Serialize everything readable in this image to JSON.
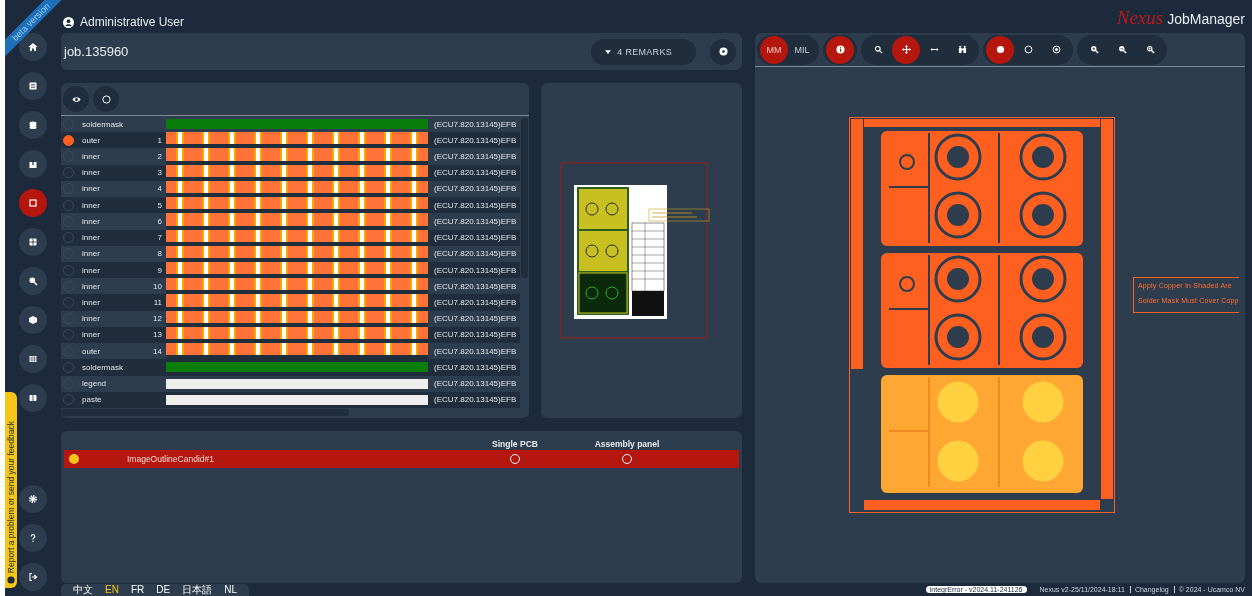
{
  "ribbon": "beta version",
  "feedback": "Report a problem or send your feedback",
  "user": "Administrative User",
  "logo": {
    "brand": "Nexus",
    "product": "JobManager"
  },
  "sidebar": {
    "items": [
      {
        "selected": false
      },
      {
        "selected": false
      },
      {
        "selected": false
      },
      {
        "selected": false
      },
      {
        "selected": true
      },
      {
        "selected": false
      },
      {
        "selected": false
      },
      {
        "selected": false
      },
      {
        "selected": false
      },
      {
        "selected": false
      }
    ],
    "bottom_items": [
      {
        "selected": false
      },
      {
        "selected": false
      },
      {
        "selected": false
      }
    ]
  },
  "job": {
    "title": "job.135960",
    "remarks_button": "4 REMARKS"
  },
  "layers": [
    {
      "name": "soldermask",
      "kind": "soldermask",
      "label": "(ECU7.820.13145)EFB",
      "selected": false
    },
    {
      "name": "outer",
      "number": "1",
      "kind": "copper",
      "label": "(ECU7.820.13145)EFB",
      "selected": true
    },
    {
      "name": "inner",
      "number": "2",
      "kind": "copper",
      "label": "(ECU7.820.13145)EFB",
      "selected": false
    },
    {
      "name": "inner",
      "number": "3",
      "kind": "copper",
      "label": "(ECU7.820.13145)EFB",
      "selected": false
    },
    {
      "name": "inner",
      "number": "4",
      "kind": "copper",
      "label": "(ECU7.820.13145)EFB",
      "selected": false
    },
    {
      "name": "inner",
      "number": "5",
      "kind": "copper",
      "label": "(ECU7.820.13145)EFB",
      "selected": false
    },
    {
      "name": "inner",
      "number": "6",
      "kind": "copper",
      "label": "(ECU7.820.13145)EFB",
      "selected": false
    },
    {
      "name": "inner",
      "number": "7",
      "kind": "copper",
      "label": "(ECU7.820.13145)EFB",
      "selected": false
    },
    {
      "name": "inner",
      "number": "8",
      "kind": "copper",
      "label": "(ECU7.820.13145)EFB",
      "selected": false
    },
    {
      "name": "inner",
      "number": "9",
      "kind": "copper",
      "label": "(ECU7.820.13145)EFB",
      "selected": false
    },
    {
      "name": "inner",
      "number": "10",
      "kind": "copper",
      "label": "(ECU7.820.13145)EFB",
      "selected": false
    },
    {
      "name": "inner",
      "number": "11",
      "kind": "copper",
      "label": "(ECU7.820.13145)EFB",
      "selected": false
    },
    {
      "name": "inner",
      "number": "12",
      "kind": "copper",
      "label": "(ECU7.820.13145)EFB",
      "selected": false
    },
    {
      "name": "inner",
      "number": "13",
      "kind": "copper",
      "label": "(ECU7.820.13145)EFB",
      "selected": false
    },
    {
      "name": "outer",
      "number": "14",
      "kind": "copper",
      "label": "(ECU7.820.13145)EFB",
      "selected": false
    },
    {
      "name": "soldermask",
      "kind": "soldermask",
      "label": "(ECU7.820.13145)EFB",
      "selected": false
    },
    {
      "name": "legend",
      "kind": "legend",
      "label": "(ECU7.820.13145)EFB",
      "selected": false
    },
    {
      "name": "paste",
      "kind": "paste",
      "label": "(ECU7.820.13145)EFB",
      "selected": false
    }
  ],
  "outlines": {
    "columns": [
      "Single PCB",
      "Assembly panel"
    ],
    "rows": [
      {
        "name": "ImageOutlineCandid#1",
        "selected": true,
        "color": "#f5c518",
        "single_pcb": false,
        "assembly_panel": false
      }
    ]
  },
  "languages": [
    {
      "label": "中文",
      "selected": false
    },
    {
      "label": "EN",
      "selected": true
    },
    {
      "label": "FR",
      "selected": false
    },
    {
      "label": "DE",
      "selected": false
    },
    {
      "label": "日本語",
      "selected": false
    },
    {
      "label": "NL",
      "selected": false
    }
  ],
  "viewer": {
    "toolbar": [
      [
        {
          "label": "MM",
          "selected": true
        },
        {
          "label": "MIL",
          "selected": false
        }
      ],
      [
        {
          "selected": true
        }
      ],
      [
        {
          "selected": false
        },
        {
          "selected": true
        },
        {
          "selected": false
        },
        {
          "selected": false
        }
      ],
      [
        {
          "selected": true
        },
        {
          "selected": false
        },
        {
          "selected": false
        }
      ],
      [
        {
          "selected": false
        },
        {
          "selected": false
        },
        {
          "selected": false
        }
      ]
    ],
    "notes": [
      "Apply Copper In Shaded Are",
      "Solder Mask Must Cover Copp"
    ]
  },
  "footer": {
    "badge": "integrError - v2024.11-241126",
    "version": "Nexus v2-25/11/2024-18:11",
    "link": "Changelog",
    "copyright": "© 2024 - Ucamco NV"
  }
}
